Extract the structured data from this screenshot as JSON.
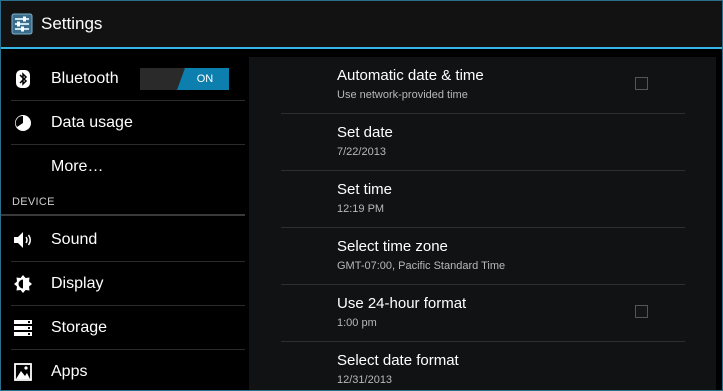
{
  "app": {
    "title": "Settings"
  },
  "sidebar": {
    "items": [
      {
        "label": "Bluetooth",
        "icon": "bluetooth-icon",
        "toggle": "ON"
      },
      {
        "label": "Data usage",
        "icon": "data-usage-icon"
      },
      {
        "label": "More…"
      },
      {
        "label": "Sound",
        "icon": "speaker-icon"
      },
      {
        "label": "Display",
        "icon": "display-brightness-icon"
      },
      {
        "label": "Storage",
        "icon": "storage-icon"
      },
      {
        "label": "Apps",
        "icon": "apps-icon"
      }
    ],
    "section_device": "DEVICE"
  },
  "prefs": [
    {
      "title": "Automatic date & time",
      "summary": "Use network-provided time",
      "checkbox": false
    },
    {
      "title": "Set date",
      "summary": "7/22/2013"
    },
    {
      "title": "Set time",
      "summary": "12:19 PM"
    },
    {
      "title": "Select time zone",
      "summary": "GMT-07:00, Pacific Standard Time"
    },
    {
      "title": "Use 24-hour format",
      "summary": "1:00 pm",
      "checkbox": false
    },
    {
      "title": "Select date format",
      "summary": "12/31/2013"
    }
  ],
  "colors": {
    "accent": "#33b5e5",
    "toggle_on": "#0d7fae"
  }
}
